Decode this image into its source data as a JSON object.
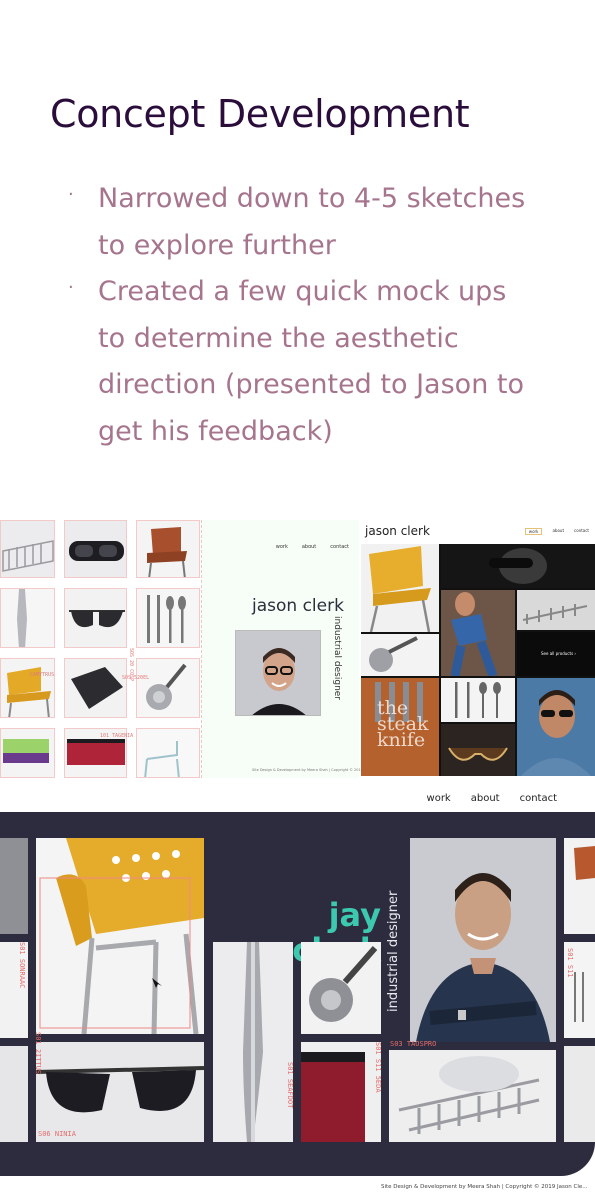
{
  "slide": {
    "title": "Concept Development",
    "bullets": [
      "Narrowed down to 4-5 sketches to explore further",
      "Created a few quick mock ups to determine the aesthetic direction (presented to Jason to get his feedback)"
    ]
  },
  "mockup_grid": {
    "tags": [
      "CAMYTRUS",
      "SOS 520EL",
      "101 TAGENIA",
      "SOS 20 COSP"
    ]
  },
  "mockup_middle": {
    "nav": [
      "work",
      "about",
      "contact"
    ],
    "name": "jason clerk",
    "subtitle": "industrial designer",
    "footer": "Site Design & Development by Meera Shah | Copyright © 2019 Jason Clerk"
  },
  "mockup_right": {
    "name": "jason clerk",
    "nav": [
      "work",
      "about",
      "contact"
    ],
    "see_all": "See all products ›",
    "knife_text": "the steak knife"
  },
  "mockup_large": {
    "nav": [
      "work",
      "about",
      "contact"
    ],
    "name_line1": "jay",
    "name_line2": "clerk",
    "subtitle": "industrial designer",
    "tags": [
      "S01 2ITTUS",
      "S01 SONRAAC",
      "S06 NINIA",
      "S01 SEAFDOT",
      "S03 TAOSPRO",
      "S01 S11 5EDA",
      "S01 S11"
    ],
    "footer": "Site Design & Development by Meera Shah | Copyright © 2019 Jason Cle..."
  },
  "colors": {
    "title": "#2a0d3a",
    "bullets": "#a6758d",
    "accent_teal": "#3cc9b0",
    "dark_bg": "#2c2c3e",
    "tag_red": "#e56b6b"
  }
}
